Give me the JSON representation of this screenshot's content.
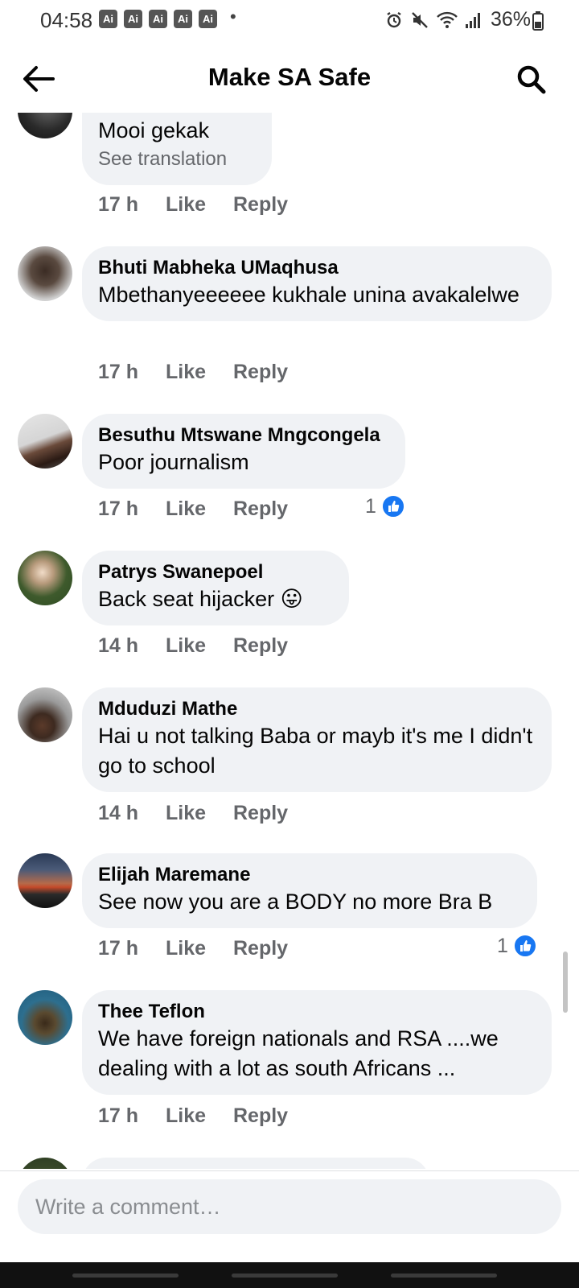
{
  "status_bar": {
    "time": "04:58",
    "badges": [
      "Ai",
      "Ai",
      "Ai",
      "Ai",
      "Ai"
    ],
    "dot": "•",
    "battery": "36%",
    "icons": [
      "alarm-icon",
      "mute-icon",
      "wifi-icon",
      "signal-icon",
      "battery-icon"
    ]
  },
  "header": {
    "title": "Make SA Safe",
    "back_icon": "arrow-left-icon",
    "search_icon": "search-icon"
  },
  "comments": [
    {
      "author": "",
      "text": "Mooi gekak",
      "see_translation": "See translation",
      "time": "17 h",
      "like": "Like",
      "reply": "Reply",
      "reactions": null
    },
    {
      "author": "Bhuti Mabheka UMaqhusa",
      "text": "Mbethanyeeeeee kukhale unina avakalelwe",
      "time": "17 h",
      "like": "Like",
      "reply": "Reply",
      "reactions": null
    },
    {
      "author": "Besuthu Mtswane Mngcongela",
      "text": "Poor journalism",
      "time": "17 h",
      "like": "Like",
      "reply": "Reply",
      "reactions": "1"
    },
    {
      "author": "Patrys Swanepoel",
      "text": "Back seat hijacker 😛",
      "time": "14 h",
      "like": "Like",
      "reply": "Reply",
      "reactions": null
    },
    {
      "author": "Mduduzi Mathe",
      "text": "Hai u not talking Baba or mayb it's me I didn't go to school",
      "time": "14 h",
      "like": "Like",
      "reply": "Reply",
      "reactions": null
    },
    {
      "author": "Elijah Maremane",
      "text": "See now you are a BODY no more Bra B",
      "time": "17 h",
      "like": "Like",
      "reply": "Reply",
      "reactions": "1"
    },
    {
      "author": "Thee Teflon",
      "text": "We have foreign nationals and RSA ....we dealing with a lot as south Africans ...",
      "time": "17 h",
      "like": "Like",
      "reply": "Reply",
      "reactions": null
    }
  ],
  "composer": {
    "placeholder": "Write a comment…"
  },
  "colors": {
    "bubble": "#f0f2f5",
    "meta_text": "#65676b",
    "like_blue": "#1877f2"
  }
}
